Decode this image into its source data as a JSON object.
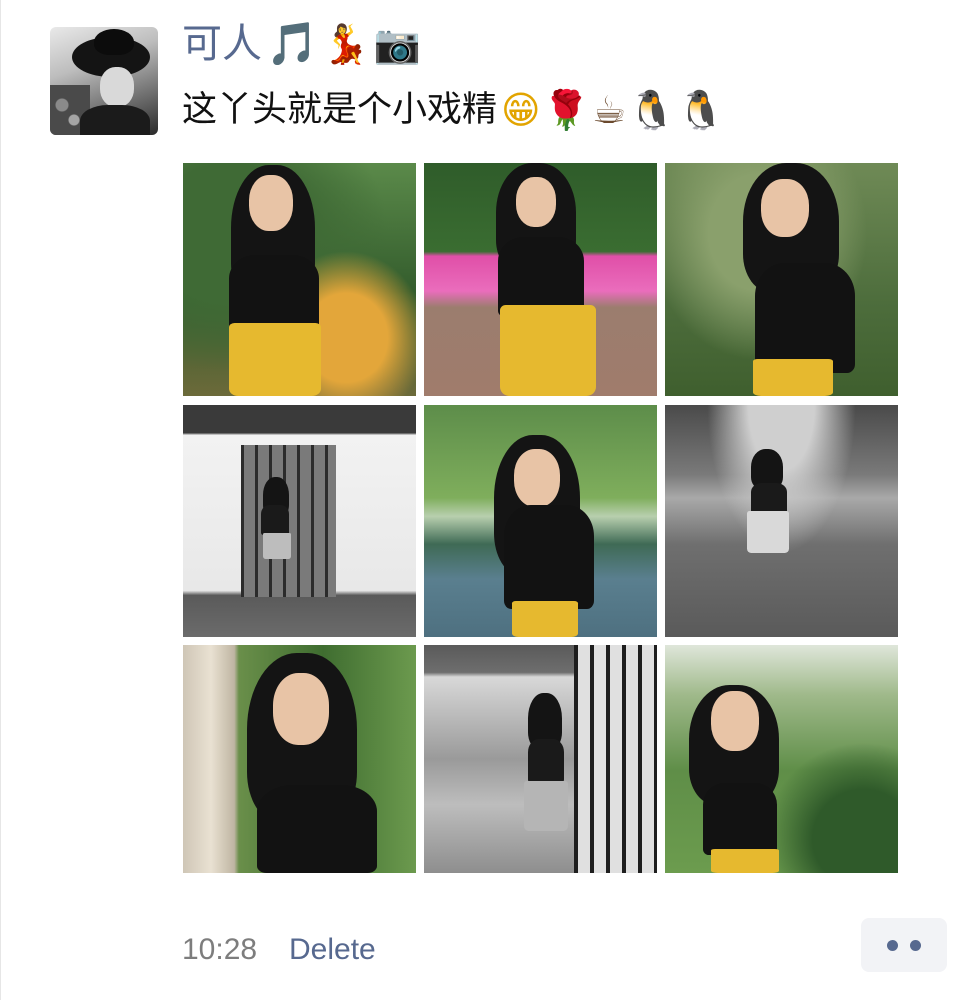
{
  "post": {
    "author_name": "可人",
    "name_emojis": [
      {
        "char": "🎵",
        "icon": "music-note-icon"
      },
      {
        "char": "💃",
        "icon": "dancer-icon"
      },
      {
        "char": "📷",
        "icon": "camera-icon"
      }
    ],
    "message_text": "这丫头就是个小戏精",
    "message_emojis": [
      {
        "char": "😁",
        "icon": "grin-icon"
      },
      {
        "char": "🌹",
        "icon": "rose-icon"
      },
      {
        "char": "☕",
        "icon": "coffee-icon"
      },
      {
        "char": "🐧",
        "icon": "penguin-icon"
      },
      {
        "char": "🐧",
        "icon": "penguin-icon"
      }
    ],
    "photos": [
      {
        "icon": "photo-thumbnail",
        "tone": "color"
      },
      {
        "icon": "photo-thumbnail",
        "tone": "color"
      },
      {
        "icon": "photo-thumbnail",
        "tone": "color"
      },
      {
        "icon": "photo-thumbnail",
        "tone": "bw"
      },
      {
        "icon": "photo-thumbnail",
        "tone": "color"
      },
      {
        "icon": "photo-thumbnail",
        "tone": "bw"
      },
      {
        "icon": "photo-thumbnail",
        "tone": "color"
      },
      {
        "icon": "photo-thumbnail",
        "tone": "bw"
      },
      {
        "icon": "photo-thumbnail",
        "tone": "color"
      }
    ],
    "timestamp": "10:28",
    "delete_label": "Delete",
    "more_icon": "more-dots-icon"
  },
  "colors": {
    "link_blue": "#57698f",
    "timestamp_gray": "#7d7d7d",
    "skirt_yellow": "#e6b92f"
  }
}
